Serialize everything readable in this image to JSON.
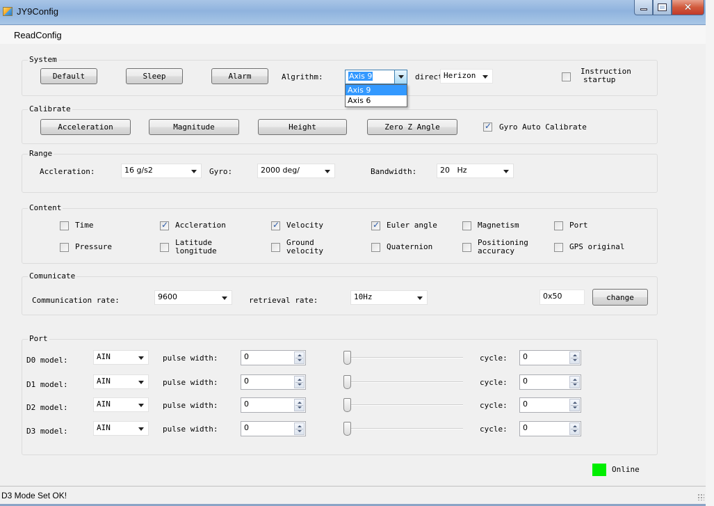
{
  "window": {
    "title": "JY9Config",
    "controls": {
      "minimize": "minimize",
      "maximize": "maximize",
      "close": "×"
    }
  },
  "menu": {
    "items": [
      {
        "label": "ReadConfig"
      }
    ]
  },
  "system": {
    "label": "System",
    "buttons": {
      "default": "Default",
      "sleep": "Sleep",
      "alarm": "Alarm"
    },
    "algorithm_label": "Algrithm:",
    "algorithm_value": "Axis 9",
    "algorithm_options": [
      "Axis 9",
      "Axis 6"
    ],
    "direction_label": "direction:",
    "direction_value": "Herizon",
    "instruction_startup": {
      "line1": "Instruction",
      "line2": "startup",
      "checked": false
    }
  },
  "calibrate": {
    "label": "Calibrate",
    "buttons": {
      "acceleration": "Acceleration",
      "magnitude": "Magnitude",
      "height": "Height",
      "zero_z": "Zero Z Angle"
    },
    "gyro_auto": {
      "label": "Gyro Auto Calibrate",
      "checked": true
    }
  },
  "range": {
    "label": "Range",
    "acceleration_label": "Accleration:",
    "acceleration_value": "16 g/s2",
    "gyro_label": "Gyro:",
    "gyro_value": "2000 deg/",
    "bandwidth_label": "Bandwidth:",
    "bandwidth_value": "20   Hz"
  },
  "content": {
    "label": "Content",
    "items": [
      {
        "line1": "Time",
        "line2": "",
        "checked": false
      },
      {
        "line1": "Accleration",
        "line2": "",
        "checked": true
      },
      {
        "line1": "Velocity",
        "line2": "",
        "checked": true
      },
      {
        "line1": "Euler angle",
        "line2": "",
        "checked": true
      },
      {
        "line1": "Magnetism",
        "line2": "",
        "checked": false
      },
      {
        "line1": "Port",
        "line2": "",
        "checked": false
      },
      {
        "line1": "Pressure",
        "line2": "",
        "checked": false
      },
      {
        "line1": "Latitude",
        "line2": "longitude",
        "checked": false
      },
      {
        "line1": "Ground",
        "line2": "velocity",
        "checked": false
      },
      {
        "line1": "Quaternion",
        "line2": "",
        "checked": false
      },
      {
        "line1": "Positioning",
        "line2": "accuracy",
        "checked": false
      },
      {
        "line1": "GPS original",
        "line2": "",
        "checked": false
      }
    ]
  },
  "communicate": {
    "label": "Comunicate",
    "rate_label": "Communication rate:",
    "rate_value": "9600",
    "retrieval_label": "retrieval rate:",
    "retrieval_value": "10Hz",
    "address_value": "0x50",
    "change_button": "change"
  },
  "port": {
    "label": "Port",
    "rows": [
      {
        "model_label": "D0 model:",
        "model_value": "AIN",
        "pulse_label": "pulse width:",
        "pulse_value": "0",
        "slider_value": 0,
        "cycle_label": "cycle:",
        "cycle_value": "0"
      },
      {
        "model_label": "D1 model:",
        "model_value": "AIN",
        "pulse_label": "pulse width:",
        "pulse_value": "0",
        "slider_value": 0,
        "cycle_label": "cycle:",
        "cycle_value": "0"
      },
      {
        "model_label": "D2 model:",
        "model_value": "AIN",
        "pulse_label": "pulse width:",
        "pulse_value": "0",
        "slider_value": 0,
        "cycle_label": "cycle:",
        "cycle_value": "0"
      },
      {
        "model_label": "D3 model:",
        "model_value": "AIN",
        "pulse_label": "pulse width:",
        "pulse_value": "0",
        "slider_value": 0,
        "cycle_label": "cycle:",
        "cycle_value": "0"
      }
    ]
  },
  "connection": {
    "status": "Online",
    "color": "#00ee00"
  },
  "statusbar": {
    "message": "D3 Mode Set OK!"
  }
}
